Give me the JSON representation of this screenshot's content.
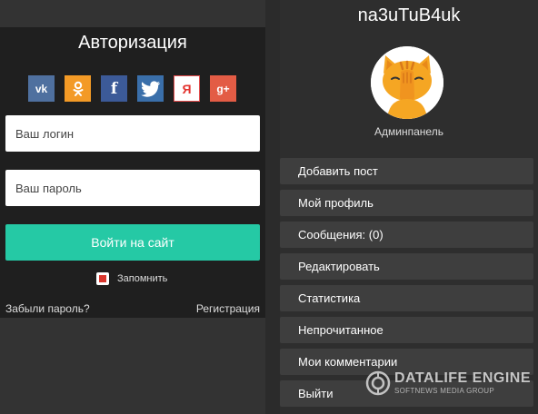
{
  "auth": {
    "title": "Авторизация",
    "social": {
      "vk": "vk",
      "ok": "ok",
      "fb": "f",
      "tw": "tw",
      "ya": "Я",
      "gp": "g+"
    },
    "login_placeholder": "Ваш логин",
    "password_placeholder": "Ваш пароль",
    "submit_label": "Войти на сайт",
    "remember_label": "Запомнить",
    "forgot_label": "Забыли пароль?",
    "register_label": "Регистрация"
  },
  "user": {
    "name": "na3uTuB4uk",
    "admin_label": "Админпанель",
    "menu": [
      "Добавить пост",
      "Мой профиль",
      "Сообщения: (0)",
      "Редактировать",
      "Статистика",
      "Непрочитанное",
      "Мои комментарии",
      "Выйти"
    ]
  },
  "watermark": {
    "line1": "DATALIFE ENGINE",
    "line2": "SOFTNEWS MEDIA GROUP"
  },
  "colors": {
    "accent": "#25c9a5",
    "remember_check": "#d9362d"
  }
}
